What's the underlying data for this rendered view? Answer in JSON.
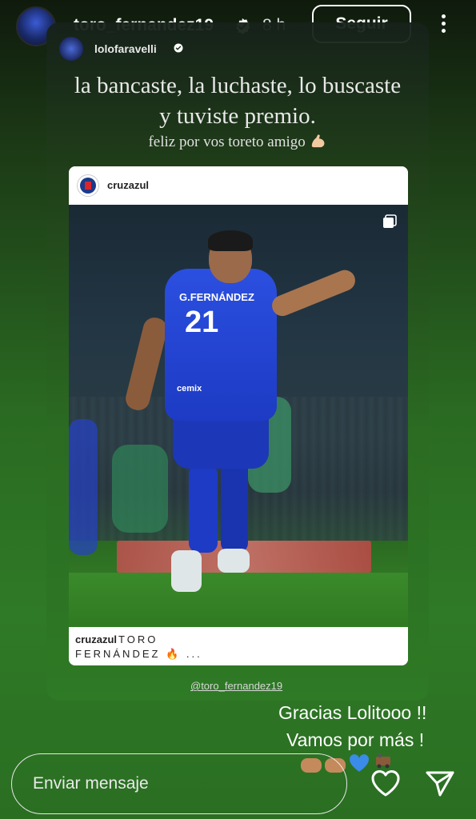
{
  "header": {
    "username": "toro_fernandez19",
    "time": "8 h",
    "follow_label": "Seguir"
  },
  "shared_story": {
    "username": "lolofaravelli",
    "caption_main": "la bancaste, la luchaste, lo buscaste y tuviste premio.",
    "caption_sub": "feliz por vos toreto amigo"
  },
  "post": {
    "author": "cruzazul",
    "jersey_name": "G.FERNÁNDEZ",
    "jersey_number": "21",
    "jersey_sponsor": "cemix",
    "caption_author": "cruzazul",
    "caption_line1": "TORO",
    "caption_line2": "FERNÁNDEZ 🔥 ..."
  },
  "mention": "@toro_fernandez19",
  "reply": {
    "line1": "Gracias Lolitooo !!",
    "line2": "Vamos por más !"
  },
  "footer": {
    "message_placeholder": "Enviar mensaje"
  },
  "colors": {
    "accent_blue": "#2b4fe0",
    "verified_blue": "#3897f0"
  },
  "icons": [
    "verified-icon",
    "more-icon",
    "muscle-icon",
    "carousel-icon",
    "heart-icon",
    "send-icon",
    "fist-icon",
    "heart-blue-icon",
    "train-icon"
  ]
}
